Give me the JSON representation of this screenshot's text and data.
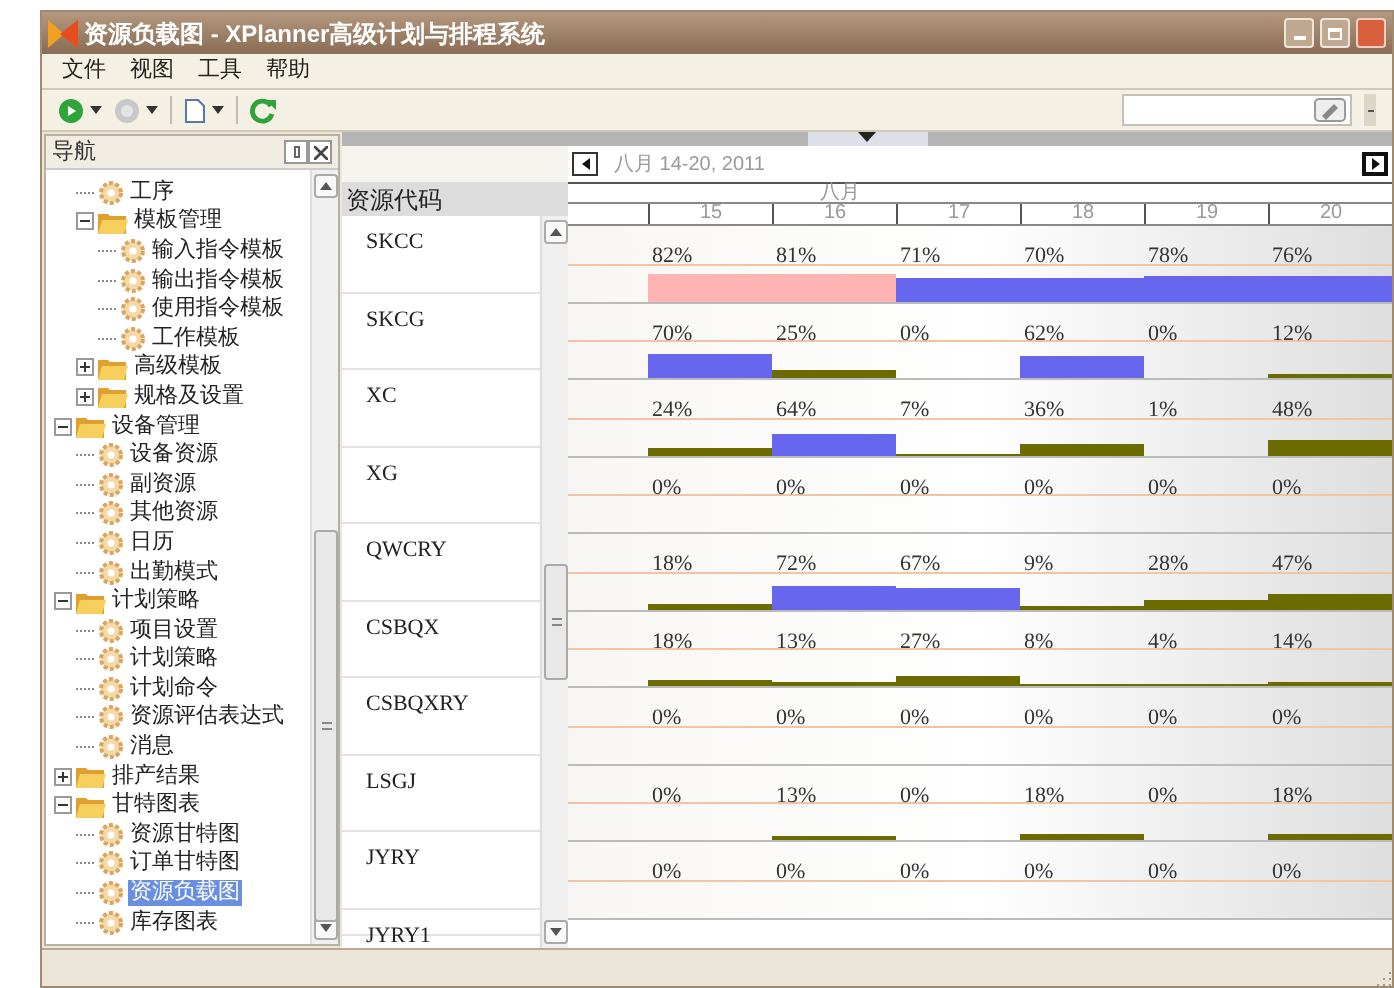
{
  "window": {
    "title": "资源负载图 - XPlanner高级计划与排程系统"
  },
  "menu": [
    "文件",
    "视图",
    "工具",
    "帮助"
  ],
  "nav": {
    "title": "导航",
    "tree": {
      "continued": [
        {
          "label": "工序",
          "kind": "leaf",
          "selected": false
        },
        {
          "label": "模板管理",
          "kind": "folder",
          "expanded": true,
          "selected": false,
          "children": [
            {
              "label": "输入指令模板",
              "kind": "leaf",
              "selected": false
            },
            {
              "label": "输出指令模板",
              "kind": "leaf",
              "selected": false
            },
            {
              "label": "使用指令模板",
              "kind": "leaf",
              "selected": false
            },
            {
              "label": "工作模板",
              "kind": "leaf",
              "selected": false
            }
          ]
        },
        {
          "label": "高级模板",
          "kind": "folder",
          "expanded": false,
          "selected": false
        },
        {
          "label": "规格及设置",
          "kind": "folder",
          "expanded": false,
          "selected": false
        }
      ],
      "items": [
        {
          "label": "设备管理",
          "kind": "folder",
          "expanded": true,
          "selected": false,
          "children": [
            {
              "label": "设备资源",
              "kind": "leaf",
              "selected": false
            },
            {
              "label": "副资源",
              "kind": "leaf",
              "selected": false
            },
            {
              "label": "其他资源",
              "kind": "leaf",
              "selected": false
            },
            {
              "label": "日历",
              "kind": "leaf",
              "selected": false
            },
            {
              "label": "出勤模式",
              "kind": "leaf",
              "selected": false
            }
          ]
        },
        {
          "label": "计划策略",
          "kind": "folder",
          "expanded": true,
          "selected": false,
          "children": [
            {
              "label": "项目设置",
              "kind": "leaf",
              "selected": false
            },
            {
              "label": "计划策略",
              "kind": "leaf",
              "selected": false
            },
            {
              "label": "计划命令",
              "kind": "leaf",
              "selected": false
            },
            {
              "label": "资源评估表达式",
              "kind": "leaf",
              "selected": false
            },
            {
              "label": "消息",
              "kind": "leaf",
              "selected": false
            }
          ]
        },
        {
          "label": "排产结果",
          "kind": "folder",
          "expanded": false,
          "selected": false
        },
        {
          "label": "甘特图表",
          "kind": "folder",
          "expanded": true,
          "selected": false,
          "children": [
            {
              "label": "资源甘特图",
              "kind": "leaf",
              "selected": false
            },
            {
              "label": "订单甘特图",
              "kind": "leaf",
              "selected": false
            },
            {
              "label": "资源负载图",
              "kind": "leaf",
              "selected": true
            },
            {
              "label": "库存图表",
              "kind": "leaf",
              "selected": false
            }
          ]
        }
      ]
    }
  },
  "gantt": {
    "range": "八月 14-20, 2011",
    "month": "八月",
    "days": [
      "15",
      "16",
      "17",
      "18",
      "19",
      "20"
    ],
    "code_header": "资源代码",
    "rows": [
      {
        "code": "SKCC",
        "loads": [
          "82%",
          "81%",
          "71%",
          "70%",
          "78%",
          "76%"
        ]
      },
      {
        "code": "SKCG",
        "loads": [
          "70%",
          "25%",
          "0%",
          "62%",
          "0%",
          "12%"
        ]
      },
      {
        "code": "XC",
        "loads": [
          "24%",
          "64%",
          "7%",
          "36%",
          "1%",
          "48%"
        ]
      },
      {
        "code": "XG",
        "loads": [
          "0%",
          "0%",
          "0%",
          "0%",
          "0%",
          "0%"
        ]
      },
      {
        "code": "QWCRY",
        "loads": [
          "18%",
          "72%",
          "67%",
          "9%",
          "28%",
          "47%"
        ]
      },
      {
        "code": "CSBQX",
        "loads": [
          "18%",
          "13%",
          "27%",
          "8%",
          "4%",
          "14%"
        ]
      },
      {
        "code": "CSBQXRY",
        "loads": [
          "0%",
          "0%",
          "0%",
          "0%",
          "0%",
          "0%"
        ]
      },
      {
        "code": "LSGJ",
        "loads": [
          "0%",
          "13%",
          "0%",
          "18%",
          "0%",
          "18%"
        ]
      },
      {
        "code": "JYRY",
        "loads": [
          "0%",
          "0%",
          "0%",
          "0%",
          "0%",
          "0%"
        ]
      },
      {
        "code": "JYRY1"
      }
    ]
  }
}
